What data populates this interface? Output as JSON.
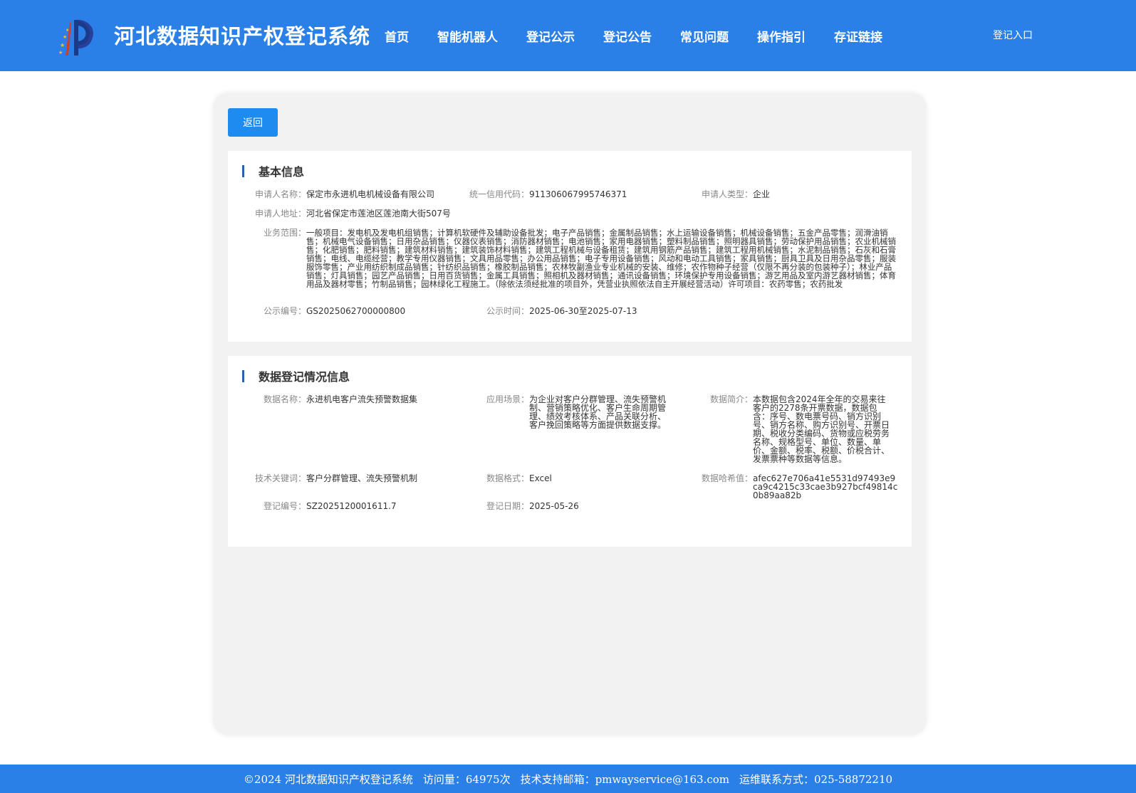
{
  "header": {
    "title": "河北数据知识产权登记系统",
    "nav": [
      "首页",
      "智能机器人",
      "登记公示",
      "登记公告",
      "常见问题",
      "操作指引",
      "存证链接"
    ],
    "login": "登记入口"
  },
  "back_label": "返回",
  "basic": {
    "title": "基本信息",
    "applicant_name_label": "申请人名称：",
    "applicant_name": "保定市永进机电机械设备有限公司",
    "credit_code_label": "统一信用代码：",
    "credit_code": "911306067995746371",
    "applicant_type_label": "申请人类型：",
    "applicant_type": "企业",
    "address_label": "申请人地址：",
    "address": "河北省保定市莲池区莲池南大街507号",
    "scope_label": "业务范围：",
    "scope": "一般项目：发电机及发电机组销售；计算机软硬件及辅助设备批发；电子产品销售；金属制品销售；水上运输设备销售；机械设备销售；五金产品零售；润滑油销售；机械电气设备销售；日用杂品销售；仪器仪表销售；消防器材销售；电池销售；家用电器销售；塑料制品销售；照明器具销售；劳动保护用品销售；农业机械销售；化肥销售；肥料销售；建筑材料销售；建筑装饰材料销售；建筑工程机械与设备租赁；建筑用钢筋产品销售；建筑工程用机械销售；水泥制品销售；石灰和石膏销售；电线、电缆经营；教学专用仪器销售；文具用品零售；办公用品销售；电子专用设备销售；风动和电动工具销售；家具销售；厨具卫具及日用杂品零售；服装服饰零售；产业用纺织制成品销售；针纺织品销售；橡胶制品销售；农林牧副渔业专业机械的安装、维修；农作物种子经营（仅限不再分装的包装种子）；林业产品销售；灯具销售；园艺产品销售；日用百货销售；金属工具销售；照相机及器材销售；通讯设备销售；环境保护专用设备销售；游艺用品及室内游艺器材销售；体育用品及器材零售；竹制品销售；园林绿化工程施工。（除依法须经批准的项目外，凭营业执照依法自主开展经营活动）许可项目：农药零售；农药批发",
    "pub_no_label": "公示编号：",
    "pub_no": "GS2025062700000800",
    "pub_time_label": "公示时间：",
    "pub_time": "2025-06-30至2025-07-13"
  },
  "data_reg": {
    "title": "数据登记情况信息",
    "name_label": "数据名称：",
    "name": "永进机电客户流失预警数据集",
    "scene_label": "应用场景：",
    "scene": "为企业对客户分群管理、流失预警机制、营销策略优化、客户生命周期管理、绩效考核体系、产品关联分析、客户挽回策略等方面提供数据支撑。",
    "intro_label": "数据简介：",
    "intro": "本数据包含2024年全年的交易来往客户的2278条开票数据，数据包含：序号、数电票号码、销方识别号、销方名称、购方识别号、开票日期、税收分类编码、货物或应税劳务名称、规格型号、单位、数量、单价、金额、税率、税额、价税合计、发票票种等数据等信息。",
    "keywords_label": "技术关键词：",
    "keywords": "客户分群管理、流失预警机制",
    "format_label": "数据格式：",
    "format": "Excel",
    "hash_label": "数据哈希值：",
    "hash": "afec627e706a41e5531d97493e9ca9c4215c33cae3b927bcf49814c0b89aa82b",
    "reg_no_label": "登记编号：",
    "reg_no": "SZ2025120001611.7",
    "reg_date_label": "登记日期：",
    "reg_date": "2025-05-26"
  },
  "footer": {
    "copyright": "©2024 河北数据知识产权登记系统",
    "visits": "访问量：64975次",
    "email": "技术支持邮箱：pmwayservice@163.com",
    "contact": "运维联系方式：025-58872210"
  },
  "colors": {
    "header_bg": "#2b80e8",
    "button_bg": "#1e8bf0",
    "section_bar": "#2962a8",
    "panel_bg": "#f2f2f2"
  }
}
